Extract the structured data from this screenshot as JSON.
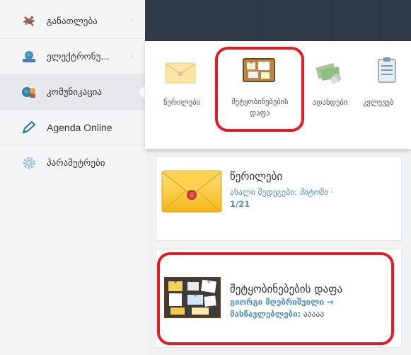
{
  "sidebar": {
    "items": [
      {
        "label": "განათლება",
        "icon": "education-icon"
      },
      {
        "label": "ელექტრონუ...",
        "icon": "globe-icon"
      },
      {
        "label": "კომუნიკაცია",
        "icon": "communication-icon",
        "active": true
      },
      {
        "label": "Agenda Online",
        "icon": "pen-icon"
      },
      {
        "label": "პარამეტრები",
        "icon": "gear-icon"
      }
    ]
  },
  "dropdown": {
    "items": [
      {
        "label": "წერილები",
        "icon": "envelope-icon"
      },
      {
        "label_line1": "შეტყობინებების",
        "label_line2": "დაფა",
        "icon": "noticeboard-icon"
      },
      {
        "label": "ადახდები",
        "icon": "payments-icon"
      },
      {
        "label": "კვლევებ",
        "icon": "survey-icon"
      }
    ]
  },
  "cards": {
    "letters": {
      "title": "წერილები",
      "sub_prefix": "ახალი შედეგები:",
      "sub_italic": "მიტოზი",
      "sub_suffix": "·",
      "sub_count": "1/21"
    },
    "board": {
      "title": "შეტყობინებების დაფა",
      "author": "გიორგი მღებრიშვილი →",
      "recipient_label": "მასწავლებლები:",
      "recipient_value": "ააააა"
    }
  },
  "colors": {
    "topbar": "#2e3a48",
    "link": "#4e8fbf",
    "annotation": "#e21b24"
  }
}
